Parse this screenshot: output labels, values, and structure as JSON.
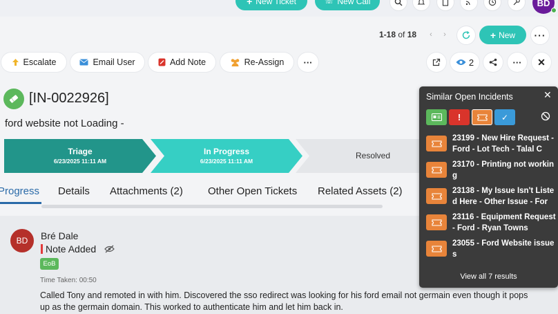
{
  "topbar": {
    "new_ticket_label": "New Ticket",
    "new_call_label": "New Call",
    "user_initials": "BD",
    "icons": [
      "search-icon",
      "bell-icon",
      "clipboard-icon",
      "rss-icon",
      "clock-icon",
      "key-icon"
    ]
  },
  "pager": {
    "range": "1-18",
    "of_label": "of",
    "total": "18",
    "new_label": "New"
  },
  "actions": {
    "escalate": "Escalate",
    "email_user": "Email User",
    "add_note": "Add Note",
    "reassign": "Re-Assign",
    "watchers_count": "2"
  },
  "ticket": {
    "id": "[IN-0022926]",
    "subject": "ford website not Loading -"
  },
  "stepper": [
    {
      "name": "Triage",
      "date": "6/23/2025 11:11 AM",
      "status": "done"
    },
    {
      "name": "In Progress",
      "date": "6/23/2025 11:11 AM",
      "status": "current"
    },
    {
      "name": "Resolved",
      "date": "",
      "status": "pending"
    }
  ],
  "tabs": [
    {
      "label": "Progress",
      "active": true
    },
    {
      "label": "Details",
      "active": false
    },
    {
      "label": "Attachments (2)",
      "active": false
    },
    {
      "label": "Other Open Tickets",
      "active": false
    },
    {
      "label": "Related Assets (2)",
      "active": false
    }
  ],
  "note": {
    "initials": "BD",
    "author": "Bré Dale",
    "type": "Note Added",
    "badge": "EoB",
    "time_taken": "Time Taken: 00:50",
    "body": "Called Tony and remoted in with him. Discovered the sso redirect was looking for his ford email not germain even though it pops up as the germain domain. This worked to authenticate him and let him back in."
  },
  "similar_panel": {
    "title": "Similar Open Incidents",
    "filters": [
      {
        "name": "id-card-filter",
        "color": "#5cb85c"
      },
      {
        "name": "exclamation-filter",
        "color": "#d9342b"
      },
      {
        "name": "ticket-filter",
        "color": "#e8843a"
      },
      {
        "name": "check-filter",
        "color": "#3a9ad9"
      }
    ],
    "items": [
      "23199 - New Hire Request - Ford - Lot Tech - Talal C",
      "23170 - Printing not working",
      "23138 - My Issue Isn't Listed Here - Other Issue - For",
      "23116 - Equipment Request - Ford - Ryan Towns",
      "23055 - Ford Website issues"
    ],
    "view_all": "View all 7 results"
  },
  "colors": {
    "accent": "#2ec4b6",
    "step_done": "#22958a",
    "step_current": "#36cfc4",
    "step_pending": "#e4e6e9",
    "link_blue": "#2a6aa8"
  }
}
